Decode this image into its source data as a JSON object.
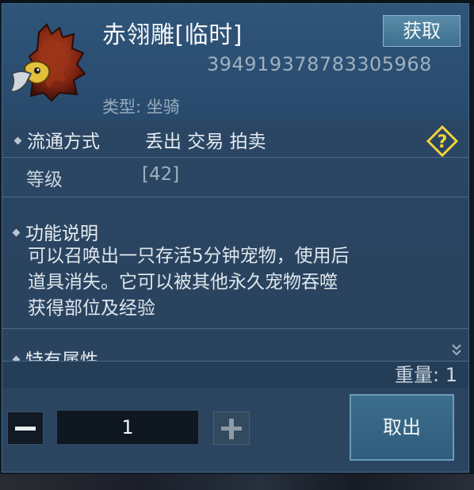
{
  "item": {
    "name": "赤翎雕[临时]",
    "id": "394919378783305968",
    "type_label": "类型: 坐骑",
    "icon": "eagle-mount-icon"
  },
  "header": {
    "get_button": "获取"
  },
  "circulation": {
    "label": "流通方式",
    "value": "丢出 交易 拍卖",
    "help_icon": "help-diamond-icon"
  },
  "level": {
    "label": "等级",
    "value": "[42]"
  },
  "function": {
    "label": "功能说明",
    "lines": [
      "可以召唤出一只存活5分钟宠物，使用后",
      "道具消失。它可以被其他永久宠物吞噬",
      "获得部位及经验"
    ]
  },
  "special": {
    "label": "特有属性"
  },
  "weight": {
    "text": "重量: 1"
  },
  "quantity": {
    "value": "1",
    "minus_icon": "minus-icon",
    "plus_icon": "plus-icon"
  },
  "actions": {
    "take_out": "取出"
  },
  "colors": {
    "panel": "#2a4663",
    "header": "#2f557a",
    "accent": "#f2d33a",
    "button": "#3c6e8c"
  }
}
